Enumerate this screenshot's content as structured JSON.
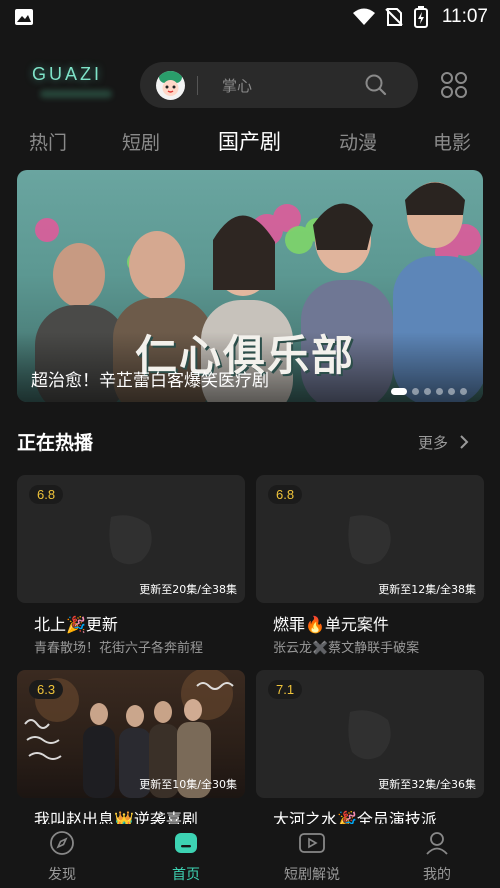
{
  "status_bar": {
    "time": "11:07"
  },
  "header": {
    "logo_text": "GUAZI",
    "search_placeholder": "掌心"
  },
  "tabs": [
    {
      "label": "热门",
      "active": false
    },
    {
      "label": "短剧",
      "active": false
    },
    {
      "label": "国产剧",
      "active": true
    },
    {
      "label": "动漫",
      "active": false
    },
    {
      "label": "电影",
      "active": false
    }
  ],
  "banner": {
    "title_art": "仁心俱乐部",
    "caption": "超治愈！辛芷蕾白客爆笑医疗剧",
    "dots": 6,
    "active_dot": 0
  },
  "section": {
    "title": "正在热播",
    "more_label": "更多"
  },
  "cards": [
    {
      "rating": "6.8",
      "update": "更新至20集/全38集",
      "title": "北上🎉更新",
      "subtitle": "青春散场！花街六子各奔前程"
    },
    {
      "rating": "6.8",
      "update": "更新至12集/全38集",
      "title": "燃罪🔥单元案件",
      "subtitle": "张云龙✖️蔡文静联手破案"
    },
    {
      "rating": "6.3",
      "update": "更新至10集/全30集",
      "title": "我叫赵出息👑逆袭喜剧",
      "subtitle": ""
    },
    {
      "rating": "7.1",
      "update": "更新至32集/全36集",
      "title": "大河之水🎉全员演技派",
      "subtitle": ""
    }
  ],
  "bottom_nav": [
    {
      "label": "发现",
      "icon": "compass-icon",
      "active": false
    },
    {
      "label": "首页",
      "icon": "home-icon",
      "active": true
    },
    {
      "label": "短剧解说",
      "icon": "video-icon",
      "active": false
    },
    {
      "label": "我的",
      "icon": "profile-icon",
      "active": false
    }
  ],
  "colors": {
    "accent": "#3dd3b3",
    "rating": "#f0c43a",
    "background": "#161616"
  }
}
